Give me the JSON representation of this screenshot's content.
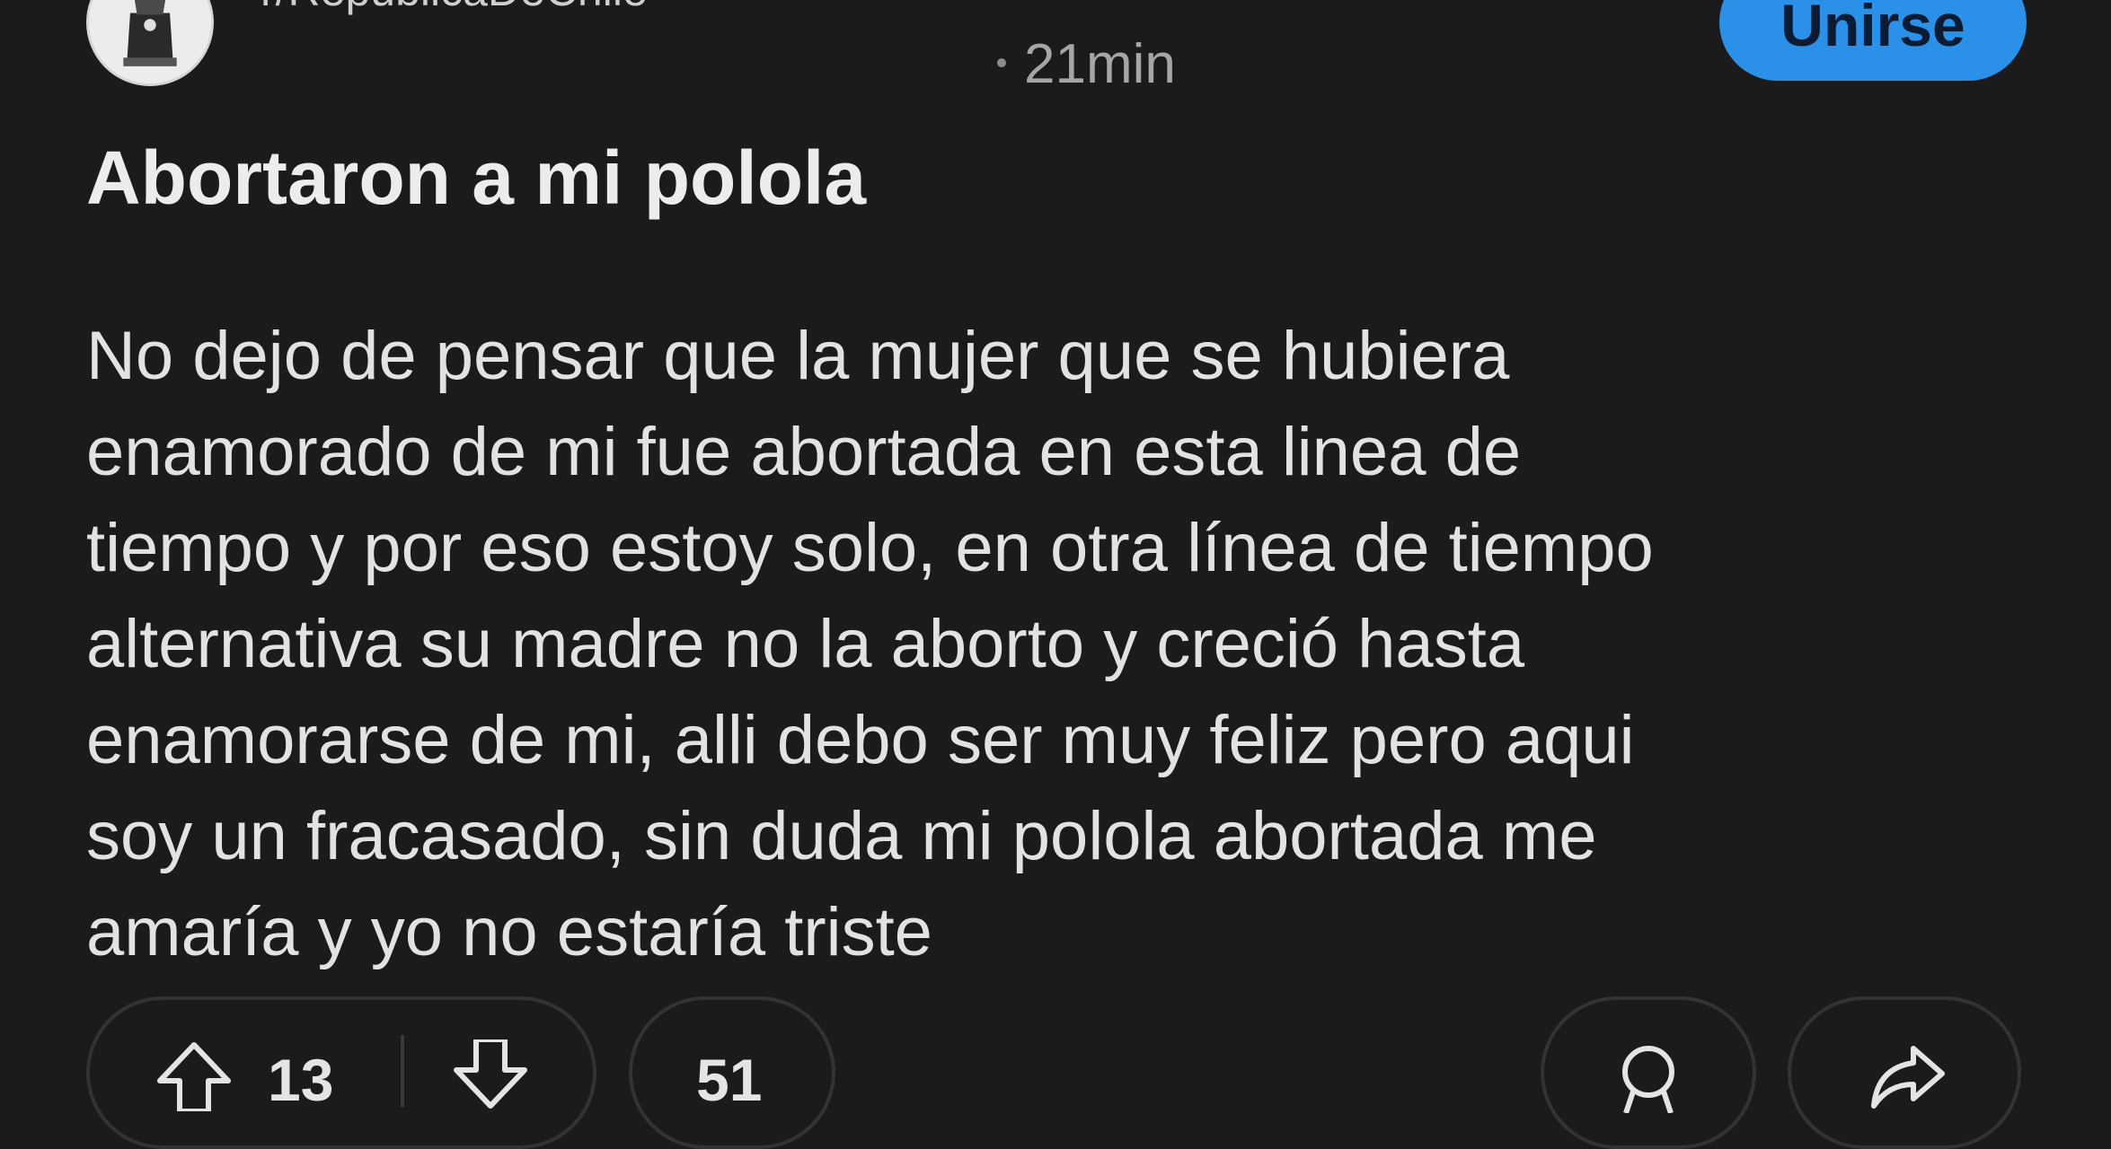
{
  "post": {
    "subreddit": "r/RepublicaDeChile",
    "time": "21min",
    "join_label": "Unirse",
    "title": "Abortaron a mi polola",
    "body_lines": [
      "No dejo de pensar que la mujer que se hubiera",
      "enamorado de mi fue abortada en esta linea de",
      "tiempo y por eso estoy solo, en otra línea de tiempo",
      "alternativa su madre no la aborto y creció hasta",
      "enamorarse de mi, alli debo ser muy feliz pero aqui",
      "soy un fracasado, sin duda mi polola abortada me",
      "amaría y yo no estaría triste"
    ]
  },
  "actions": {
    "upvotes": "13",
    "comments": "51",
    "icons": {
      "upvote": "upvote-arrow-icon",
      "downvote": "downvote-arrow-icon",
      "award": "award-icon",
      "share": "share-icon"
    }
  },
  "colors": {
    "background": "#1b1b1b",
    "join_button": "#2a90e8",
    "text": "#e6e6e6",
    "muted": "#a6a6a6"
  }
}
